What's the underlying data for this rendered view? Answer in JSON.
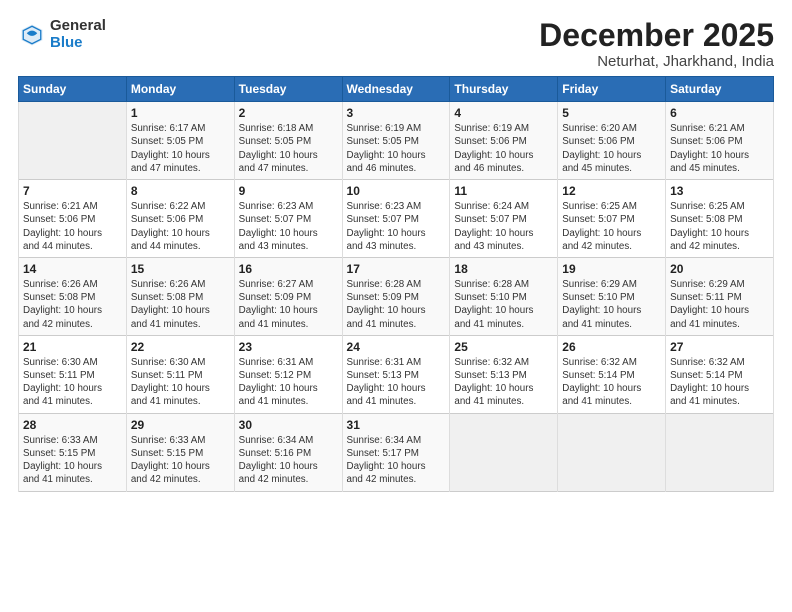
{
  "logo": {
    "general": "General",
    "blue": "Blue"
  },
  "header": {
    "month": "December 2025",
    "location": "Neturhat, Jharkhand, India"
  },
  "days_of_week": [
    "Sunday",
    "Monday",
    "Tuesday",
    "Wednesday",
    "Thursday",
    "Friday",
    "Saturday"
  ],
  "weeks": [
    [
      {
        "day": "",
        "info": ""
      },
      {
        "day": "1",
        "info": "Sunrise: 6:17 AM\nSunset: 5:05 PM\nDaylight: 10 hours\nand 47 minutes."
      },
      {
        "day": "2",
        "info": "Sunrise: 6:18 AM\nSunset: 5:05 PM\nDaylight: 10 hours\nand 47 minutes."
      },
      {
        "day": "3",
        "info": "Sunrise: 6:19 AM\nSunset: 5:05 PM\nDaylight: 10 hours\nand 46 minutes."
      },
      {
        "day": "4",
        "info": "Sunrise: 6:19 AM\nSunset: 5:06 PM\nDaylight: 10 hours\nand 46 minutes."
      },
      {
        "day": "5",
        "info": "Sunrise: 6:20 AM\nSunset: 5:06 PM\nDaylight: 10 hours\nand 45 minutes."
      },
      {
        "day": "6",
        "info": "Sunrise: 6:21 AM\nSunset: 5:06 PM\nDaylight: 10 hours\nand 45 minutes."
      }
    ],
    [
      {
        "day": "7",
        "info": "Sunrise: 6:21 AM\nSunset: 5:06 PM\nDaylight: 10 hours\nand 44 minutes."
      },
      {
        "day": "8",
        "info": "Sunrise: 6:22 AM\nSunset: 5:06 PM\nDaylight: 10 hours\nand 44 minutes."
      },
      {
        "day": "9",
        "info": "Sunrise: 6:23 AM\nSunset: 5:07 PM\nDaylight: 10 hours\nand 43 minutes."
      },
      {
        "day": "10",
        "info": "Sunrise: 6:23 AM\nSunset: 5:07 PM\nDaylight: 10 hours\nand 43 minutes."
      },
      {
        "day": "11",
        "info": "Sunrise: 6:24 AM\nSunset: 5:07 PM\nDaylight: 10 hours\nand 43 minutes."
      },
      {
        "day": "12",
        "info": "Sunrise: 6:25 AM\nSunset: 5:07 PM\nDaylight: 10 hours\nand 42 minutes."
      },
      {
        "day": "13",
        "info": "Sunrise: 6:25 AM\nSunset: 5:08 PM\nDaylight: 10 hours\nand 42 minutes."
      }
    ],
    [
      {
        "day": "14",
        "info": "Sunrise: 6:26 AM\nSunset: 5:08 PM\nDaylight: 10 hours\nand 42 minutes."
      },
      {
        "day": "15",
        "info": "Sunrise: 6:26 AM\nSunset: 5:08 PM\nDaylight: 10 hours\nand 41 minutes."
      },
      {
        "day": "16",
        "info": "Sunrise: 6:27 AM\nSunset: 5:09 PM\nDaylight: 10 hours\nand 41 minutes."
      },
      {
        "day": "17",
        "info": "Sunrise: 6:28 AM\nSunset: 5:09 PM\nDaylight: 10 hours\nand 41 minutes."
      },
      {
        "day": "18",
        "info": "Sunrise: 6:28 AM\nSunset: 5:10 PM\nDaylight: 10 hours\nand 41 minutes."
      },
      {
        "day": "19",
        "info": "Sunrise: 6:29 AM\nSunset: 5:10 PM\nDaylight: 10 hours\nand 41 minutes."
      },
      {
        "day": "20",
        "info": "Sunrise: 6:29 AM\nSunset: 5:11 PM\nDaylight: 10 hours\nand 41 minutes."
      }
    ],
    [
      {
        "day": "21",
        "info": "Sunrise: 6:30 AM\nSunset: 5:11 PM\nDaylight: 10 hours\nand 41 minutes."
      },
      {
        "day": "22",
        "info": "Sunrise: 6:30 AM\nSunset: 5:11 PM\nDaylight: 10 hours\nand 41 minutes."
      },
      {
        "day": "23",
        "info": "Sunrise: 6:31 AM\nSunset: 5:12 PM\nDaylight: 10 hours\nand 41 minutes."
      },
      {
        "day": "24",
        "info": "Sunrise: 6:31 AM\nSunset: 5:13 PM\nDaylight: 10 hours\nand 41 minutes."
      },
      {
        "day": "25",
        "info": "Sunrise: 6:32 AM\nSunset: 5:13 PM\nDaylight: 10 hours\nand 41 minutes."
      },
      {
        "day": "26",
        "info": "Sunrise: 6:32 AM\nSunset: 5:14 PM\nDaylight: 10 hours\nand 41 minutes."
      },
      {
        "day": "27",
        "info": "Sunrise: 6:32 AM\nSunset: 5:14 PM\nDaylight: 10 hours\nand 41 minutes."
      }
    ],
    [
      {
        "day": "28",
        "info": "Sunrise: 6:33 AM\nSunset: 5:15 PM\nDaylight: 10 hours\nand 41 minutes."
      },
      {
        "day": "29",
        "info": "Sunrise: 6:33 AM\nSunset: 5:15 PM\nDaylight: 10 hours\nand 42 minutes."
      },
      {
        "day": "30",
        "info": "Sunrise: 6:34 AM\nSunset: 5:16 PM\nDaylight: 10 hours\nand 42 minutes."
      },
      {
        "day": "31",
        "info": "Sunrise: 6:34 AM\nSunset: 5:17 PM\nDaylight: 10 hours\nand 42 minutes."
      },
      {
        "day": "",
        "info": ""
      },
      {
        "day": "",
        "info": ""
      },
      {
        "day": "",
        "info": ""
      }
    ]
  ]
}
